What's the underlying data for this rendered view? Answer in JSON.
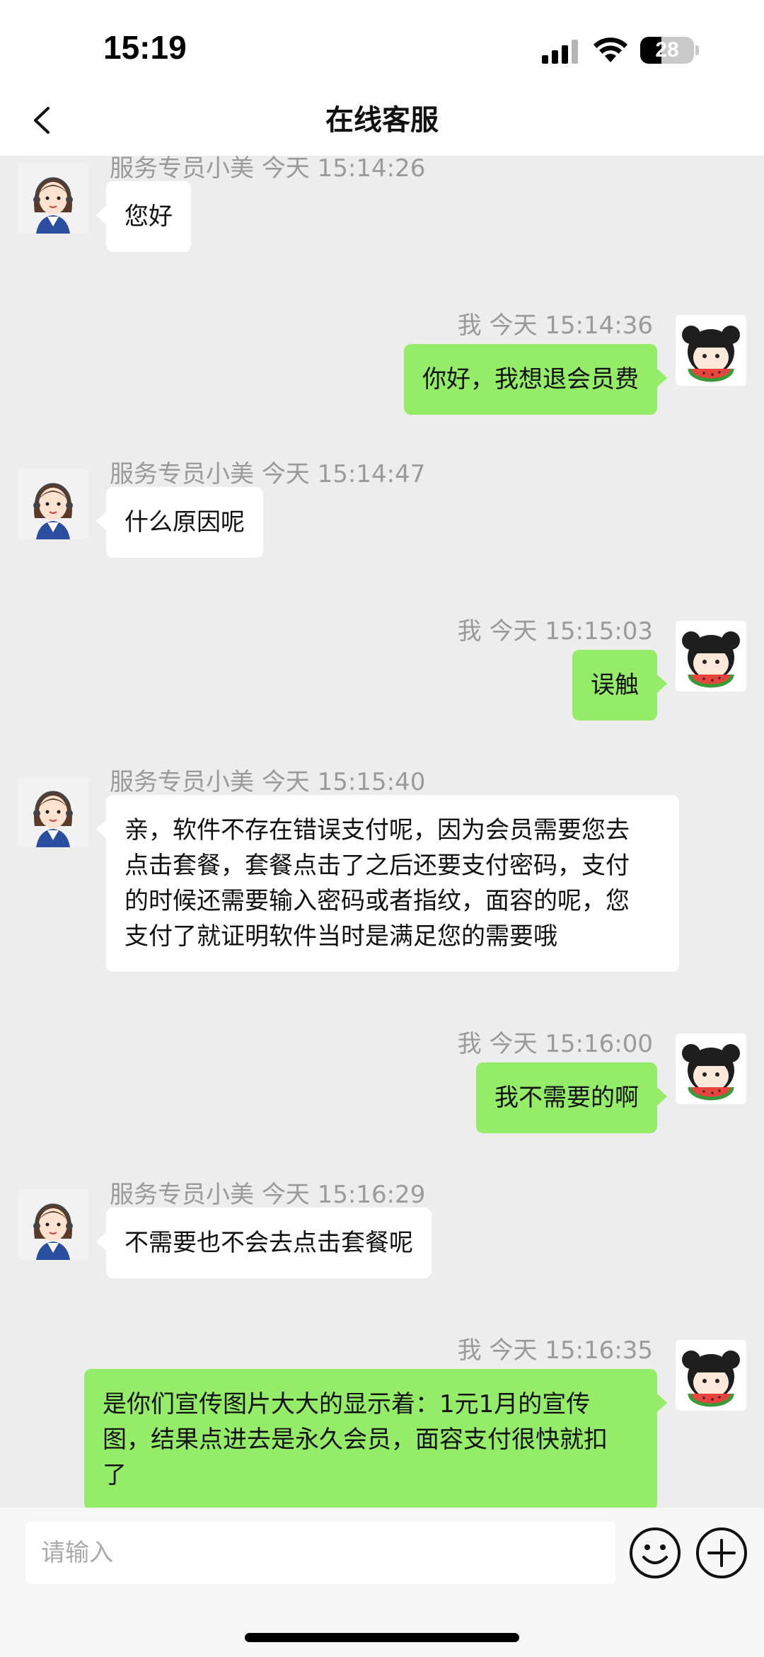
{
  "status_bar": {
    "time": "15:19",
    "battery": "28"
  },
  "header": {
    "title": "在线客服"
  },
  "messages": [
    {
      "side": "left",
      "sender": "服务专员小美",
      "time_label": "今天 15:14:26",
      "text": "您好"
    },
    {
      "side": "right",
      "sender": "我",
      "time_label": "今天 15:14:36",
      "text": "你好，我想退会员费"
    },
    {
      "side": "left",
      "sender": "服务专员小美",
      "time_label": "今天 15:14:47",
      "text": "什么原因呢"
    },
    {
      "side": "right",
      "sender": "我",
      "time_label": "今天 15:15:03",
      "text": "误触"
    },
    {
      "side": "left",
      "sender": "服务专员小美",
      "time_label": "今天 15:15:40",
      "lines": [
        "亲，软件不存在错误支付呢，因为会员需要您去",
        "点击套餐，套餐点击了之后还要支付密码，支付",
        "的时候还需要输入密码或者指纹，面容的呢，您",
        "支付了就证明软件当时是满足您的需要哦"
      ]
    },
    {
      "side": "right",
      "sender": "我",
      "time_label": "今天 15:16:00",
      "text": "我不需要的啊"
    },
    {
      "side": "left",
      "sender": "服务专员小美",
      "time_label": "今天 15:16:29",
      "text": "不需要也不会去点击套餐呢"
    },
    {
      "side": "right",
      "sender": "我",
      "time_label": "今天 15:16:35",
      "lines": [
        "是你们宣传图片大大的显示着：1元1月的宣传",
        "图，结果点进去是永久会员，面容支付很快就扣",
        "了"
      ]
    }
  ],
  "input": {
    "placeholder": "请输入",
    "value": ""
  },
  "icons": {
    "back": "chevron-left-icon",
    "emoji": "emoji-icon",
    "plus": "plus-icon",
    "agent_avatar": "agent-avatar",
    "user_avatar": "user-avatar"
  },
  "colors": {
    "self_bubble": "#95ec69",
    "other_bubble": "#ffffff",
    "background": "#ededed"
  }
}
